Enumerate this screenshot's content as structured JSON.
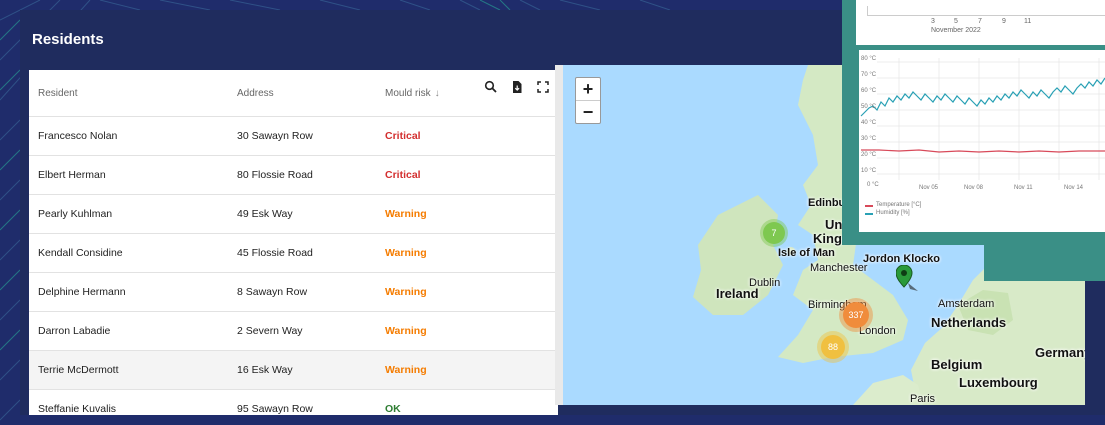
{
  "window": {
    "title": "Residents"
  },
  "table": {
    "columns": [
      "Resident",
      "Address",
      "Mould risk"
    ],
    "rows": [
      {
        "resident": "Francesco Nolan",
        "address": "30 Sawayn Row",
        "risk": "Critical"
      },
      {
        "resident": "Elbert Herman",
        "address": "80 Flossie Road",
        "risk": "Critical"
      },
      {
        "resident": "Pearly Kuhlman",
        "address": "49 Esk Way",
        "risk": "Warning"
      },
      {
        "resident": "Kendall Considine",
        "address": "45 Flossie Road",
        "risk": "Warning"
      },
      {
        "resident": "Delphine Hermann",
        "address": "8 Sawayn Row",
        "risk": "Warning"
      },
      {
        "resident": "Darron Labadie",
        "address": "2 Severn Way",
        "risk": "Warning"
      },
      {
        "resident": "Terrie McDermott",
        "address": "16 Esk Way",
        "risk": "Warning"
      },
      {
        "resident": "Steffanie Kuvalis",
        "address": "95 Sawayn Row",
        "risk": "OK"
      }
    ],
    "sort_indicator": "↓",
    "toolbar": {
      "search_icon": "search-icon",
      "export_icon": "file-download-icon",
      "fullscreen_icon": "fullscreen-icon"
    }
  },
  "map": {
    "zoom_in": "+",
    "zoom_out": "−",
    "labels": {
      "edinburgh": "Edinbur",
      "united_kingdom_1": "Unite",
      "united_kingdom_2": "Kingdom",
      "isle_of_man": "Isle of Man",
      "manchester": "Manchester",
      "dublin": "Dublin",
      "ireland": "Ireland",
      "birmingham": "Birmingham",
      "london": "London",
      "amsterdam": "Amsterdam",
      "netherlands": "Netherlands",
      "germany": "Germany",
      "belgium": "Belgium",
      "luxembourg": "Luxembourg",
      "paris": "Paris",
      "marker": "Jordon Klocko"
    },
    "clusters": [
      {
        "count": "7",
        "color": "#7ec850"
      },
      {
        "count": "337",
        "color": "#f08c3c"
      },
      {
        "count": "88",
        "color": "#f0c040"
      }
    ]
  },
  "overlay": {
    "x_ticks": [
      "3",
      "5",
      "7",
      "9",
      "11"
    ],
    "month_label": "November 2022",
    "y_ticks": [
      "80 °C",
      "70 °C",
      "60 °C",
      "50 °C",
      "40 °C",
      "30 °C",
      "20 °C",
      "10 °C",
      "0 °C"
    ],
    "x_dates": [
      "Nov 05",
      "Nov 08",
      "Nov 11",
      "Nov 14"
    ],
    "legend": [
      {
        "name": "Temperature [°C]",
        "color": "#d84a5a"
      },
      {
        "name": "Humidity [%]",
        "color": "#2aa1b5"
      }
    ]
  },
  "colors": {
    "brand": "#1f2c5e",
    "teal": "#3a8f86"
  }
}
